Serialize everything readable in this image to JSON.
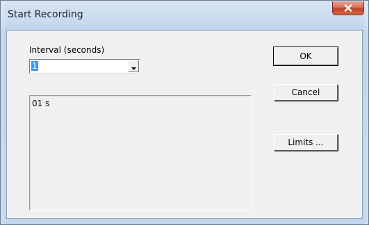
{
  "window": {
    "title": "Start Recording",
    "close_icon": "close-icon"
  },
  "interval": {
    "label": "Interval (seconds)",
    "selected": "1",
    "arrow_icon": "chevron-down-icon"
  },
  "list": {
    "items": [
      "01 s"
    ]
  },
  "buttons": {
    "ok": "OK",
    "cancel": "Cancel",
    "limits": "Limits ..."
  },
  "colors": {
    "selection": "#3399ff",
    "close_button": "#c0432b",
    "title_bar": "#c9dbee"
  }
}
